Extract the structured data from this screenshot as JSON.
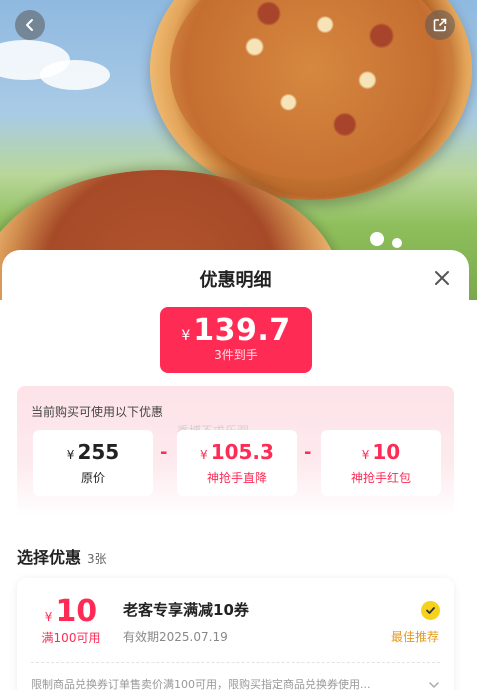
{
  "hero": {
    "back_icon": "chevron-left-icon",
    "share_icon": "share-icon"
  },
  "sheet": {
    "title": "优惠明细",
    "close_icon": "close-icon",
    "final_price": {
      "currency": "¥",
      "amount": "139.7",
      "subtitle": "3件到手"
    },
    "breakdown": {
      "title": "当前购买可使用以下优惠",
      "watermark": "秀博不求乐观",
      "items": [
        {
          "currency": "¥",
          "value": "255",
          "label": "原价"
        },
        {
          "currency": "¥",
          "value": "105.3",
          "label": "神抢手直降"
        },
        {
          "currency": "¥",
          "value": "10",
          "label": "神抢手红包"
        }
      ],
      "operator": "-"
    },
    "select_section": {
      "title": "选择优惠",
      "count": "3张"
    },
    "coupon": {
      "currency": "¥",
      "value": "10",
      "condition": "满100可用",
      "name": "老客专享满减10券",
      "expiry": "有效期2025.07.19",
      "tag": "最佳推荐",
      "selected": true,
      "description": "限制商品兑换券订单售卖价满100可用，限购买指定商品兑换券使用...",
      "expand_icon": "chevron-down-icon"
    }
  },
  "colors": {
    "accent": "#fe2c55",
    "best_tag": "#e39a1a",
    "check": "#f6d21c"
  }
}
